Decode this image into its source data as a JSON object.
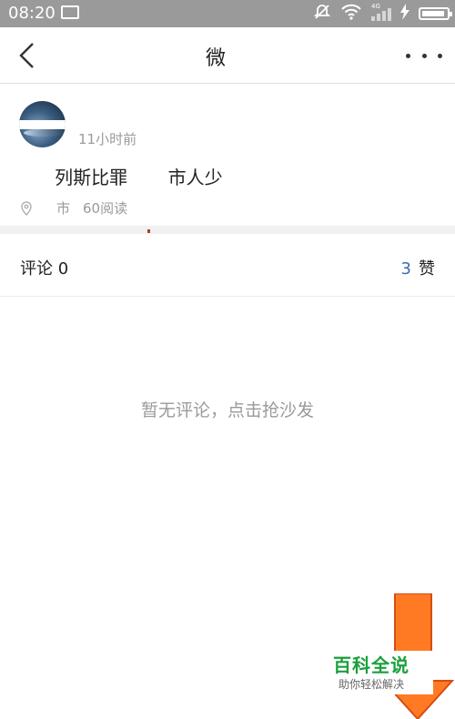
{
  "status_bar": {
    "time": "08:20",
    "network_label": "4G"
  },
  "nav": {
    "title": "微 "
  },
  "post": {
    "author": "",
    "time": "11小时前",
    "text": "      列斯比罪       市人少",
    "location": "市",
    "reads": "60阅读"
  },
  "comments": {
    "label": "评论 0",
    "likes_count": "3",
    "likes_label": "赞",
    "empty_text": "暂无评论，点击抢沙发"
  },
  "watermark": {
    "title": "百科全说",
    "subtitle": "助你轻松解决"
  },
  "colors": {
    "status_bar": "#9a9a9a",
    "likes_accent": "#3b6ea8",
    "watermark_green": "#1aa03c",
    "arrow_orange": "#ff7a22"
  }
}
